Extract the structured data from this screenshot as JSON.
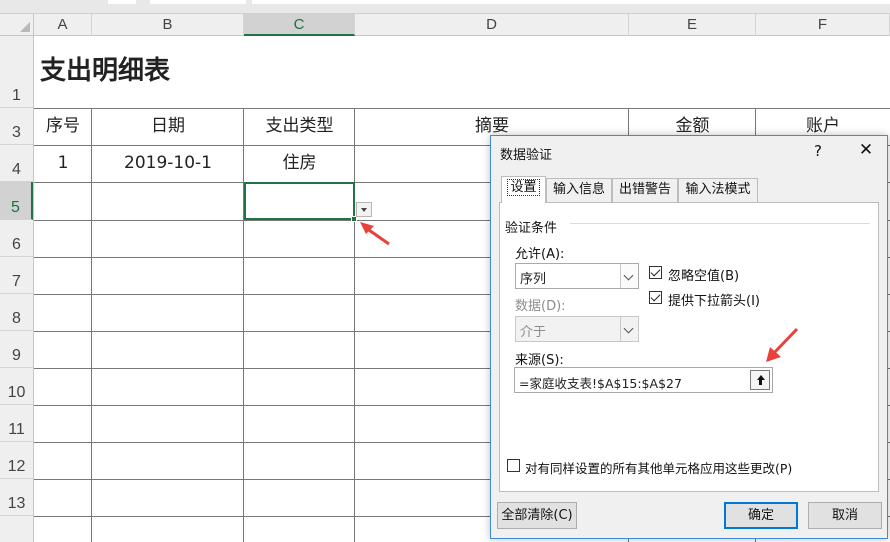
{
  "columns": [
    "A",
    "B",
    "C",
    "D",
    "E",
    "F"
  ],
  "rows": [
    "1",
    "3",
    "4",
    "5",
    "6",
    "7",
    "8",
    "9",
    "10",
    "11",
    "12",
    "13"
  ],
  "sheet": {
    "title": "支出明细表",
    "headers": [
      "序号",
      "日期",
      "支出类型",
      "摘要",
      "金额",
      "账户"
    ],
    "row4": [
      "1",
      "2019-10-1",
      "住房"
    ]
  },
  "dialog": {
    "title": "数据验证",
    "help": "?",
    "close": "✕",
    "tabs": [
      "设置",
      "输入信息",
      "出错警告",
      "输入法模式"
    ],
    "group_label": "验证条件",
    "allow_label": "允许(A):",
    "allow_value": "序列",
    "ignore_blank": "忽略空值(B)",
    "dropdown_arrow": "提供下拉箭头(I)",
    "data_label": "数据(D):",
    "data_value": "介于",
    "source_label": "来源(S):",
    "source_value": "=家庭收支表!$A$15:$A$27",
    "apply_all": "对有同样设置的所有其他单元格应用这些更改(P)",
    "clear_all": "全部清除(C)",
    "ok": "确定",
    "cancel": "取消"
  },
  "colors": {
    "selection": "#217346",
    "arrow": "#e8413a",
    "dialog_border": "#3c8ad8"
  }
}
